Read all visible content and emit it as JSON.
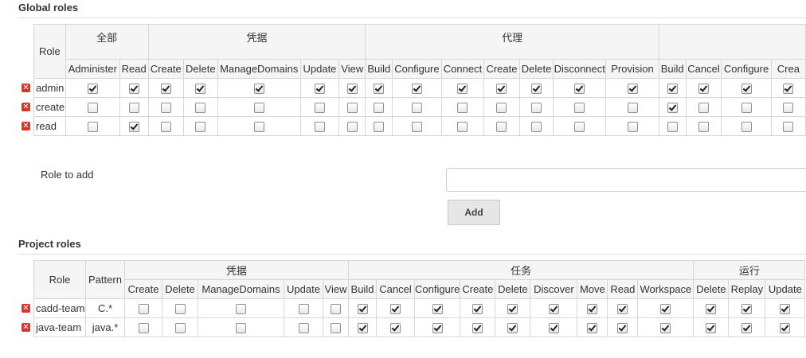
{
  "global": {
    "title": "Global roles",
    "role_header": "Role",
    "groups": [
      "全部",
      "凭据",
      "代理",
      ""
    ],
    "columns": [
      "Administer",
      "Read",
      "Create",
      "Delete",
      "ManageDomains",
      "Update",
      "View",
      "Build",
      "Configure",
      "Connect",
      "Create",
      "Delete",
      "Disconnect",
      "Provision",
      "Build",
      "Cancel",
      "Configure",
      "Crea"
    ],
    "rows": [
      {
        "name": "admin",
        "checks": [
          1,
          1,
          1,
          1,
          1,
          1,
          1,
          1,
          1,
          1,
          1,
          1,
          1,
          1,
          1,
          1,
          1,
          1
        ]
      },
      {
        "name": "create",
        "checks": [
          0,
          0,
          0,
          0,
          0,
          0,
          0,
          0,
          0,
          0,
          0,
          0,
          0,
          0,
          1,
          0,
          0,
          0
        ]
      },
      {
        "name": "read",
        "checks": [
          0,
          1,
          0,
          0,
          0,
          0,
          0,
          0,
          0,
          0,
          0,
          0,
          0,
          0,
          0,
          0,
          0,
          0
        ]
      }
    ]
  },
  "add_role": {
    "label": "Role to add",
    "input_value": "",
    "button_label": "Add"
  },
  "project": {
    "title": "Project roles",
    "role_header": "Role",
    "pattern_header": "Pattern",
    "groups": [
      "凭据",
      "任务",
      "运行"
    ],
    "columns": [
      "Create",
      "Delete",
      "ManageDomains",
      "Update",
      "View",
      "Build",
      "Cancel",
      "Configure",
      "Create",
      "Delete",
      "Discover",
      "Move",
      "Read",
      "Workspace",
      "Delete",
      "Replay",
      "Update"
    ],
    "rows": [
      {
        "name": "cadd-team",
        "pattern": "C.*",
        "checks": [
          0,
          0,
          0,
          0,
          0,
          1,
          1,
          1,
          1,
          1,
          1,
          1,
          1,
          1,
          1,
          1,
          1
        ]
      },
      {
        "name": "java-team",
        "pattern": "java.*",
        "checks": [
          0,
          0,
          0,
          0,
          0,
          1,
          1,
          1,
          1,
          1,
          1,
          1,
          1,
          1,
          1,
          1,
          1
        ]
      }
    ]
  },
  "icons": {
    "delete": "delete-icon",
    "checkbox": "checkbox"
  },
  "colors": {
    "delete_icon": "#d9342b",
    "header_bg": "#f5f5f5",
    "border": "#d6d6d6"
  }
}
